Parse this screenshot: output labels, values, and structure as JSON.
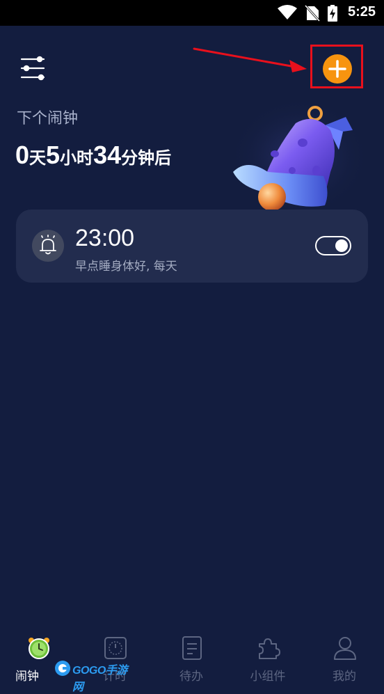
{
  "status_bar": {
    "time": "5:25"
  },
  "header": {
    "settings_icon": "sliders-icon",
    "add_icon": "plus-icon"
  },
  "next_alarm": {
    "label": "下个闹钟",
    "days": "0",
    "days_unit": "天",
    "hours": "5",
    "hours_unit": "小时",
    "minutes": "34",
    "minutes_unit": "分钟后"
  },
  "alarms": [
    {
      "time": "23:00",
      "description": "早点睡身体好, 每天",
      "enabled": true,
      "icon": "bell-icon"
    }
  ],
  "bottom_nav": [
    {
      "label": "闹钟",
      "icon": "alarm-clock-icon",
      "active": true
    },
    {
      "label": "计时",
      "icon": "timer-icon",
      "active": false
    },
    {
      "label": "待办",
      "icon": "todo-icon",
      "active": false
    },
    {
      "label": "小组件",
      "icon": "puzzle-icon",
      "active": false
    },
    {
      "label": "我的",
      "icon": "person-icon",
      "active": false
    }
  ],
  "watermark": {
    "text": "GOGO手游网"
  },
  "colors": {
    "background": "#131d3f",
    "card": "#222c4e",
    "accent": "#f7940f",
    "highlight": "#e8101c",
    "nav_inactive": "#5d6682"
  }
}
